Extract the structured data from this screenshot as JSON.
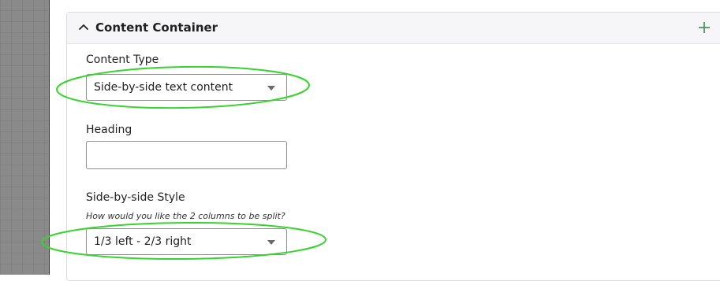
{
  "panel": {
    "title": "Content Container",
    "collapse_icon": "chevron-up-icon",
    "add_icon": "plus-icon"
  },
  "fields": {
    "content_type": {
      "label": "Content Type",
      "value": "Side-by-side text content"
    },
    "heading": {
      "label": "Heading",
      "value": ""
    },
    "side_style": {
      "label": "Side-by-side Style",
      "hint": "How would you like the 2 columns to be split?",
      "value": "1/3 left - 2/3 right"
    }
  },
  "colors": {
    "annotation": "#39d32f",
    "add_icon": "#3c8a54",
    "header_bg": "#f6f6f8"
  }
}
